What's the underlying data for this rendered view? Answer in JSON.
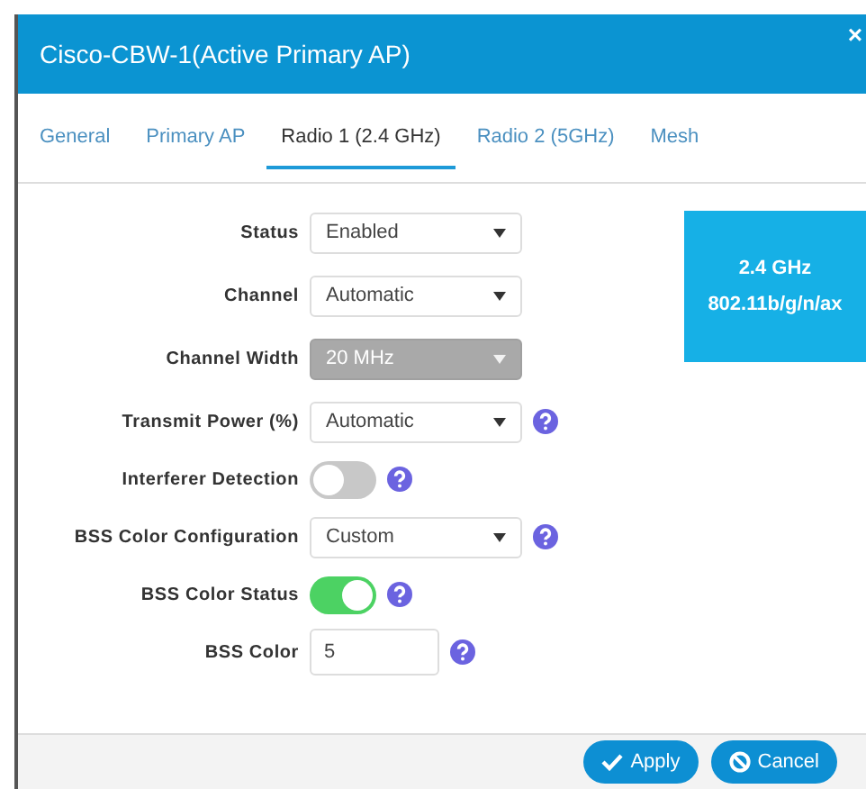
{
  "dialog": {
    "title": "Cisco-CBW-1(Active Primary AP)",
    "close": "×"
  },
  "tabs": [
    {
      "label": "General",
      "selected": false
    },
    {
      "label": "Primary AP",
      "selected": false
    },
    {
      "label": "Radio 1 (2.4 GHz)",
      "selected": true
    },
    {
      "label": "Radio 2 (5GHz)",
      "selected": false
    },
    {
      "label": "Mesh",
      "selected": false
    }
  ],
  "fields": [
    {
      "kind": "select",
      "label": "Status",
      "value": "Enabled",
      "disabled": false,
      "help": false
    },
    {
      "kind": "select",
      "label": "Channel",
      "value": "Automatic",
      "disabled": false,
      "help": false
    },
    {
      "kind": "select",
      "label": "Channel Width",
      "value": "20 MHz",
      "disabled": true,
      "help": false
    },
    {
      "kind": "select",
      "label": "Transmit Power (%)",
      "value": "Automatic",
      "disabled": false,
      "help": true
    },
    {
      "kind": "toggle",
      "label": "Interferer Detection",
      "on": false,
      "help": true
    },
    {
      "kind": "select",
      "label": "BSS Color Configuration",
      "value": "Custom",
      "disabled": false,
      "help": true
    },
    {
      "kind": "toggle",
      "label": "BSS Color Status",
      "on": true,
      "help": true
    },
    {
      "kind": "input",
      "label": "BSS Color",
      "value": "5",
      "help": true
    }
  ],
  "band_card": {
    "lines": [
      "2.4 GHz",
      "802.11b/g/n/ax"
    ]
  },
  "buttons": [
    {
      "kind": "apply",
      "label": "Apply"
    },
    {
      "kind": "cancel",
      "label": "Cancel"
    }
  ]
}
